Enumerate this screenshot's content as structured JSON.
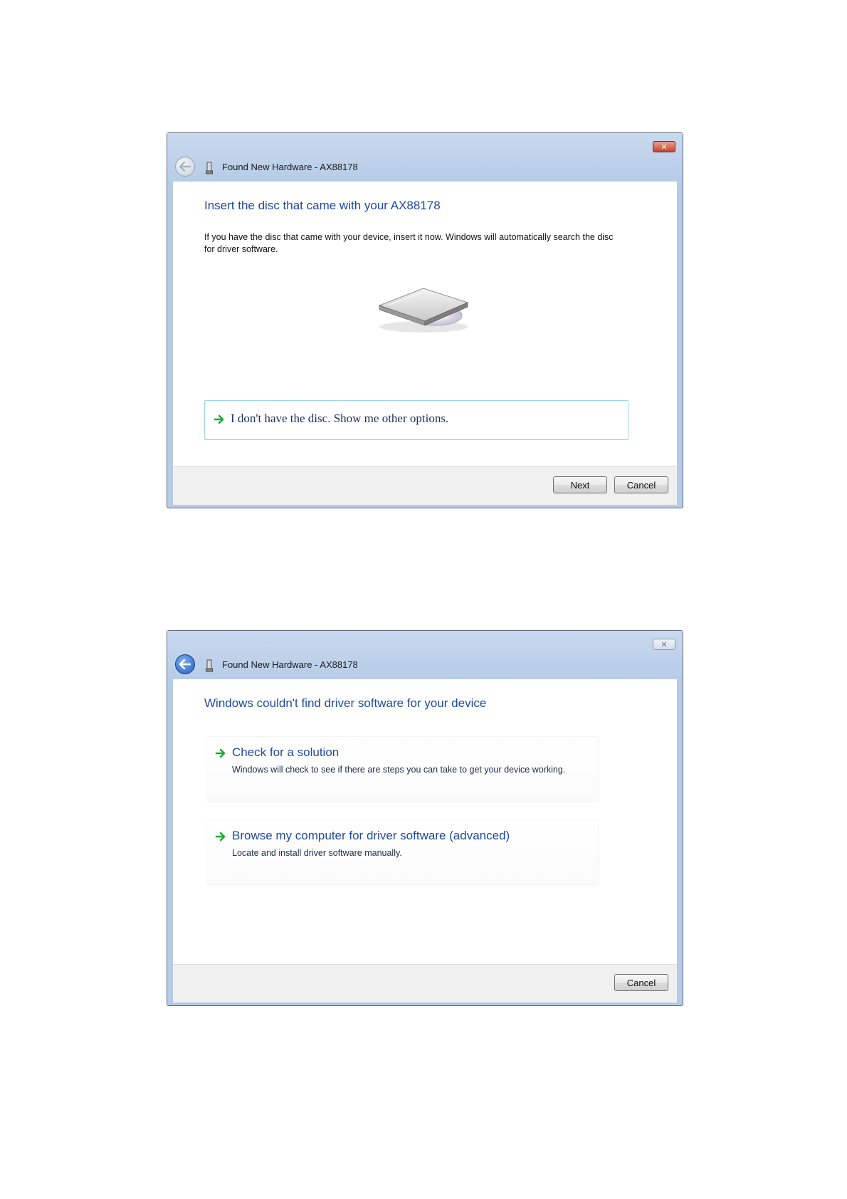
{
  "dialog1": {
    "title": "Found New Hardware - AX88178",
    "close_glyph": "✕",
    "heading": "Insert the disc that came with your AX88178",
    "body": "If you have the disc that came with your device, insert it now.  Windows will automatically search the disc for driver software.",
    "option_label": "I don't have the disc.  Show me other options.",
    "buttons": {
      "next": "Next",
      "cancel": "Cancel"
    },
    "back_enabled": false
  },
  "dialog2": {
    "title": "Found New Hardware - AX88178",
    "close_glyph": "✕",
    "heading": "Windows couldn't find driver software for your device",
    "links": [
      {
        "title": "Check for a solution",
        "description": "Windows will check to see if there are steps you can take to get your device working."
      },
      {
        "title": "Browse my computer for driver software (advanced)",
        "description": "Locate and install driver software manually."
      }
    ],
    "buttons": {
      "cancel": "Cancel"
    },
    "back_enabled": true
  },
  "icons": {
    "back": "back-arrow-icon",
    "hardware": "usb-device-icon",
    "option_arrow": "green-arrow-icon",
    "close": "close-icon",
    "disc_drive": "disc-drive-icon"
  },
  "colors": {
    "heading_blue": "#1e4aa3",
    "titlebar": "#b7cce7",
    "option_border": "#9ed4ee",
    "arrow_green": "#1aaa3a"
  }
}
